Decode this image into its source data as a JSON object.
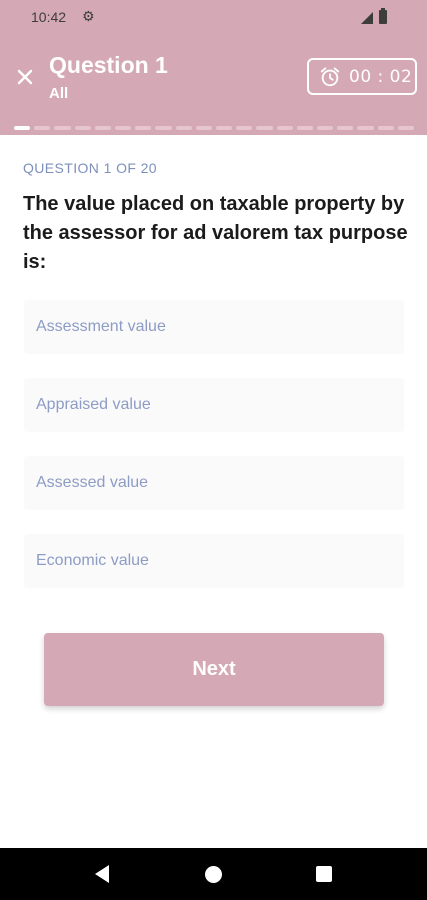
{
  "status_bar": {
    "time": "10:42",
    "settings_icon": "gear-icon",
    "signal_icon": "signal-icon",
    "battery_icon": "battery-icon"
  },
  "header": {
    "close_icon": "close-icon",
    "title": "Question 1",
    "subtitle": "All",
    "timer_icon": "alarm-clock-icon",
    "timer_value": "00 : 02",
    "background_color": "#d5a8b5"
  },
  "progress": {
    "total_segments": 20,
    "current": 1
  },
  "question": {
    "counter": "QUESTION 1 OF 20",
    "text": "The value placed on taxable property by the assessor for ad valorem tax purpose is:"
  },
  "options": [
    {
      "label": "Assessment value"
    },
    {
      "label": "Appraised value"
    },
    {
      "label": "Assessed value"
    },
    {
      "label": "Economic value"
    }
  ],
  "next_button": {
    "label": "Next"
  },
  "nav_bar": {
    "back_icon": "back-icon",
    "home_icon": "home-icon",
    "recents_icon": "recents-icon"
  }
}
